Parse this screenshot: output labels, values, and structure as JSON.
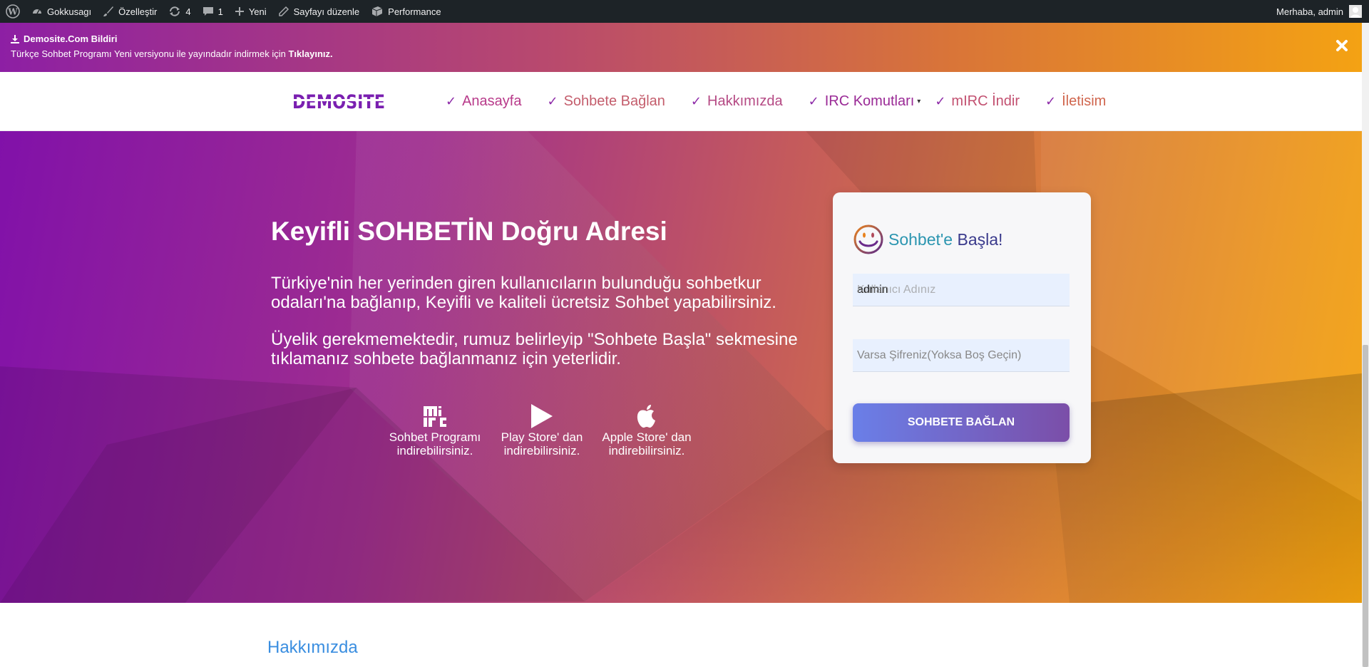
{
  "adminbar": {
    "site_name": "Gokkusagı",
    "customize": "Özelleştir",
    "updates_count": "4",
    "comments_count": "1",
    "new_label": "Yeni",
    "edit_page": "Sayfayı düzenle",
    "performance": "Performance",
    "greeting": "Merhaba, admin"
  },
  "notice": {
    "title": "Demosite.Com Bildiri",
    "text": "Türkçe Sohbet Programı Yeni versiyonu ile yayındadır indirmek için",
    "link": "Tıklayınız."
  },
  "header": {
    "logo_text": "DEMOSITE",
    "nav": [
      {
        "label": "Anasayfa",
        "color": "#b83a8a"
      },
      {
        "label": "Sohbete Bağlan",
        "color": "#c45d6c"
      },
      {
        "label": "Hakkımızda",
        "color": "#b54a84"
      },
      {
        "label": "IRC Komutları",
        "color": "#9a2a96"
      },
      {
        "label": "mIRC İndir",
        "color": "#c25070"
      },
      {
        "label": "İletisim",
        "color": "#d0664e"
      }
    ]
  },
  "hero": {
    "title": "Keyifli SOHBETİN Doğru Adresi",
    "paragraph1": "Türkiye'nin her yerinden giren kullanıcıların bulunduğu sohbetkur odaları'na bağlanıp, Keyifli ve kaliteli ücretsiz Sohbet yapabilirsiniz.",
    "paragraph2": "Üyelik gerekmemektedir, rumuz belirleyip \"Sohbete Başla\" sekmesine tıklamanız sohbete bağlanmanız için yeterlidir.",
    "downloads": [
      {
        "line1": "Sohbet Programı",
        "line2": "indirebilirsiniz.",
        "icon": "mirc-icon"
      },
      {
        "line1": "Play Store' dan",
        "line2": "indirebilirsiniz.",
        "icon": "play-icon"
      },
      {
        "line1": "Apple Store' dan",
        "line2": "indirebilirsiniz.",
        "icon": "apple-icon"
      }
    ]
  },
  "login": {
    "title_part1": "Sohbet'e ",
    "title_part2": "Başla!",
    "username_placeholder": "Kullanıcı Adınız",
    "username_value": "admin",
    "password_placeholder": "Varsa Şifreniz(Yoksa Boş Geçin)",
    "button": "SOHBETE BAĞLAN"
  },
  "about": {
    "heading": "Hakkımızda"
  },
  "colors": {
    "accent_purple": "#8111a9",
    "accent_orange": "#f6a50f",
    "link_blue": "#3a8ee0"
  }
}
